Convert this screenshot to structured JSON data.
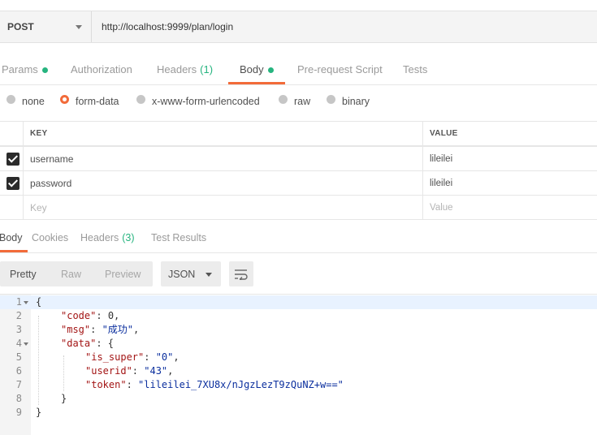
{
  "request": {
    "method": "POST",
    "url": "http://localhost:9999/plan/login"
  },
  "request_tabs": [
    {
      "label": "Params",
      "dot": true
    },
    {
      "label": "Authorization"
    },
    {
      "label": "Headers",
      "count": "(1)"
    },
    {
      "label": "Body",
      "dot": true,
      "active": true
    },
    {
      "label": "Pre-request Script"
    },
    {
      "label": "Tests"
    }
  ],
  "body_types": [
    {
      "label": "none"
    },
    {
      "label": "form-data",
      "selected": true
    },
    {
      "label": "x-www-form-urlencoded"
    },
    {
      "label": "raw"
    },
    {
      "label": "binary"
    }
  ],
  "form_table": {
    "key_header": "KEY",
    "value_header": "VALUE",
    "rows": [
      {
        "key": "username",
        "value": "lileilei",
        "checked": true
      },
      {
        "key": "password",
        "value": "lileilei",
        "checked": true
      }
    ],
    "key_placeholder": "Key",
    "value_placeholder": "Value"
  },
  "response_tabs": [
    {
      "label": "Body",
      "active": true
    },
    {
      "label": "Cookies"
    },
    {
      "label": "Headers",
      "count": "(3)"
    },
    {
      "label": "Test Results"
    }
  ],
  "response_toolbar": {
    "views": [
      "Pretty",
      "Raw",
      "Preview"
    ],
    "active_view": "Pretty",
    "format": "JSON",
    "wrap_icon": "wrap-lines-icon"
  },
  "response_body": {
    "line_numbers": [
      "1",
      "2",
      "3",
      "4",
      "5",
      "6",
      "7",
      "8",
      "9"
    ],
    "open_brace": "{",
    "code_key": "\"code\"",
    "code_value": "0",
    "msg_key": "\"msg\"",
    "msg_value": "\"成功\"",
    "data_key": "\"data\"",
    "is_super_key": "\"is_super\"",
    "is_super_value": "\"0\"",
    "userid_key": "\"userid\"",
    "userid_value": "\"43\"",
    "token_key": "\"token\"",
    "token_value": "\"lileilei_7XU8x/nJgzLezT9zQuNZ+w==\"",
    "close_inner": "}",
    "close_outer": "}"
  },
  "colors": {
    "accent": "#f26b3a",
    "green": "#26b47f"
  }
}
